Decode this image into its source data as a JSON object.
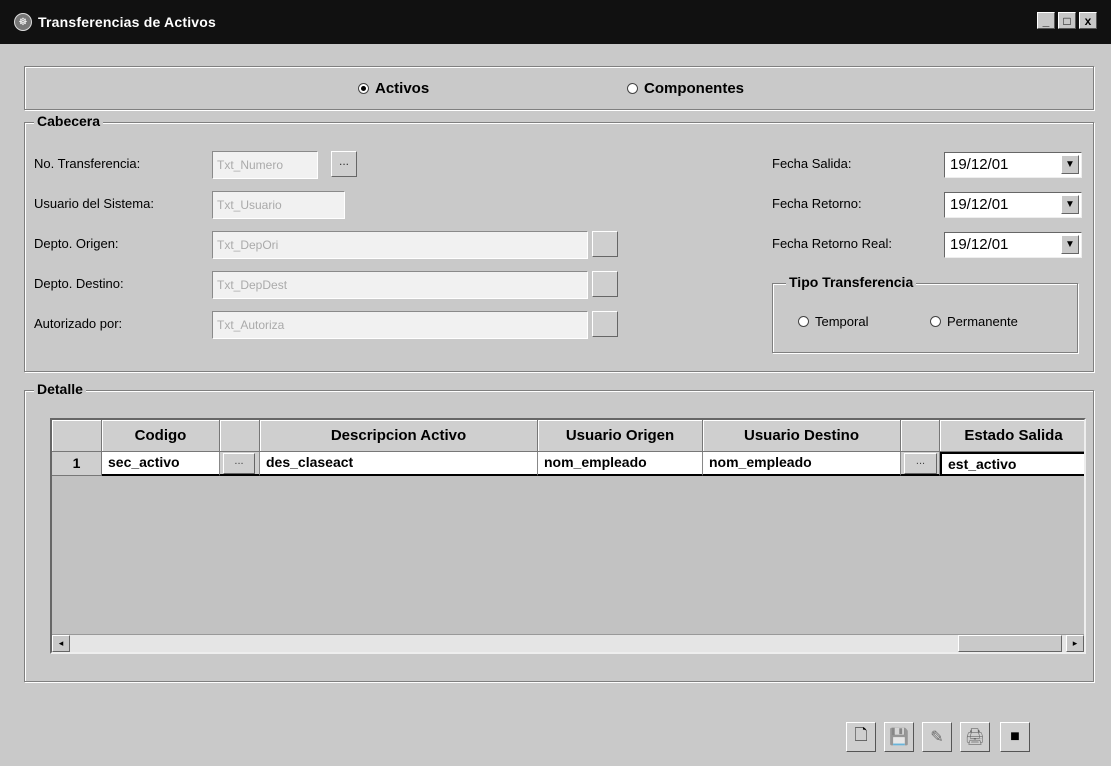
{
  "window": {
    "title": "Transferencias de Activos",
    "controls": [
      "_",
      "□",
      "x"
    ]
  },
  "mode": {
    "options": [
      {
        "label": "Activos",
        "selected": true
      },
      {
        "label": "Componentes",
        "selected": false
      }
    ]
  },
  "cabecera": {
    "legend": "Cabecera",
    "numero": {
      "label": "No. Transferencia:",
      "value": "Txt_Numero"
    },
    "usuario": {
      "label": "Usuario del Sistema:",
      "value": "Txt_Usuario"
    },
    "origen": {
      "label": "Depto. Origen:",
      "value": "Txt_DepOri"
    },
    "destino": {
      "label": "Depto. Destino:",
      "value": "Txt_DepDest"
    },
    "autorizado": {
      "label": "Autorizado por:",
      "value": "Txt_Autoriza"
    },
    "browse_label": "...",
    "fecha_salida": {
      "label": "Fecha Salida:",
      "value": "19/12/01"
    },
    "fecha_retorno": {
      "label": "Fecha Retorno:",
      "value": "19/12/01"
    },
    "fecha_retorno_real": {
      "label": "Fecha Retorno Real:",
      "value": "19/12/01"
    },
    "tipo": {
      "legend": "Tipo Transferencia",
      "options": [
        {
          "label": "Temporal",
          "selected": false
        },
        {
          "label": "Permanente",
          "selected": false
        }
      ]
    }
  },
  "detalle": {
    "legend": "Detalle",
    "columns": [
      "",
      "Codigo",
      "",
      "Descripcion Activo",
      "Usuario Origen",
      "Usuario Destino",
      "",
      "Estado Salida"
    ],
    "rows": [
      {
        "num": "1",
        "codigo": "sec_activo",
        "descripcion": "des_claseact",
        "usuario_origen": "nom_empleado",
        "usuario_destino": "nom_empleado",
        "estado": "est_activo"
      }
    ],
    "cell_button": "...",
    "scroll_left": "◂",
    "scroll_right": "▸"
  },
  "toolbar": {
    "buttons": [
      {
        "name": "new",
        "icon": "new-document-icon",
        "glyph": "🗋"
      },
      {
        "name": "save",
        "icon": "save-icon",
        "glyph": "💾"
      },
      {
        "name": "edit",
        "icon": "edit-icon",
        "glyph": "✎"
      },
      {
        "name": "print",
        "icon": "print-icon",
        "glyph": "🖨"
      },
      {
        "name": "exit",
        "icon": "exit-icon",
        "glyph": "■"
      }
    ]
  },
  "colors": {
    "titlebar": "#111111",
    "window_bg": "#c9c9c9",
    "grid_row_bg": "#ffffff"
  }
}
